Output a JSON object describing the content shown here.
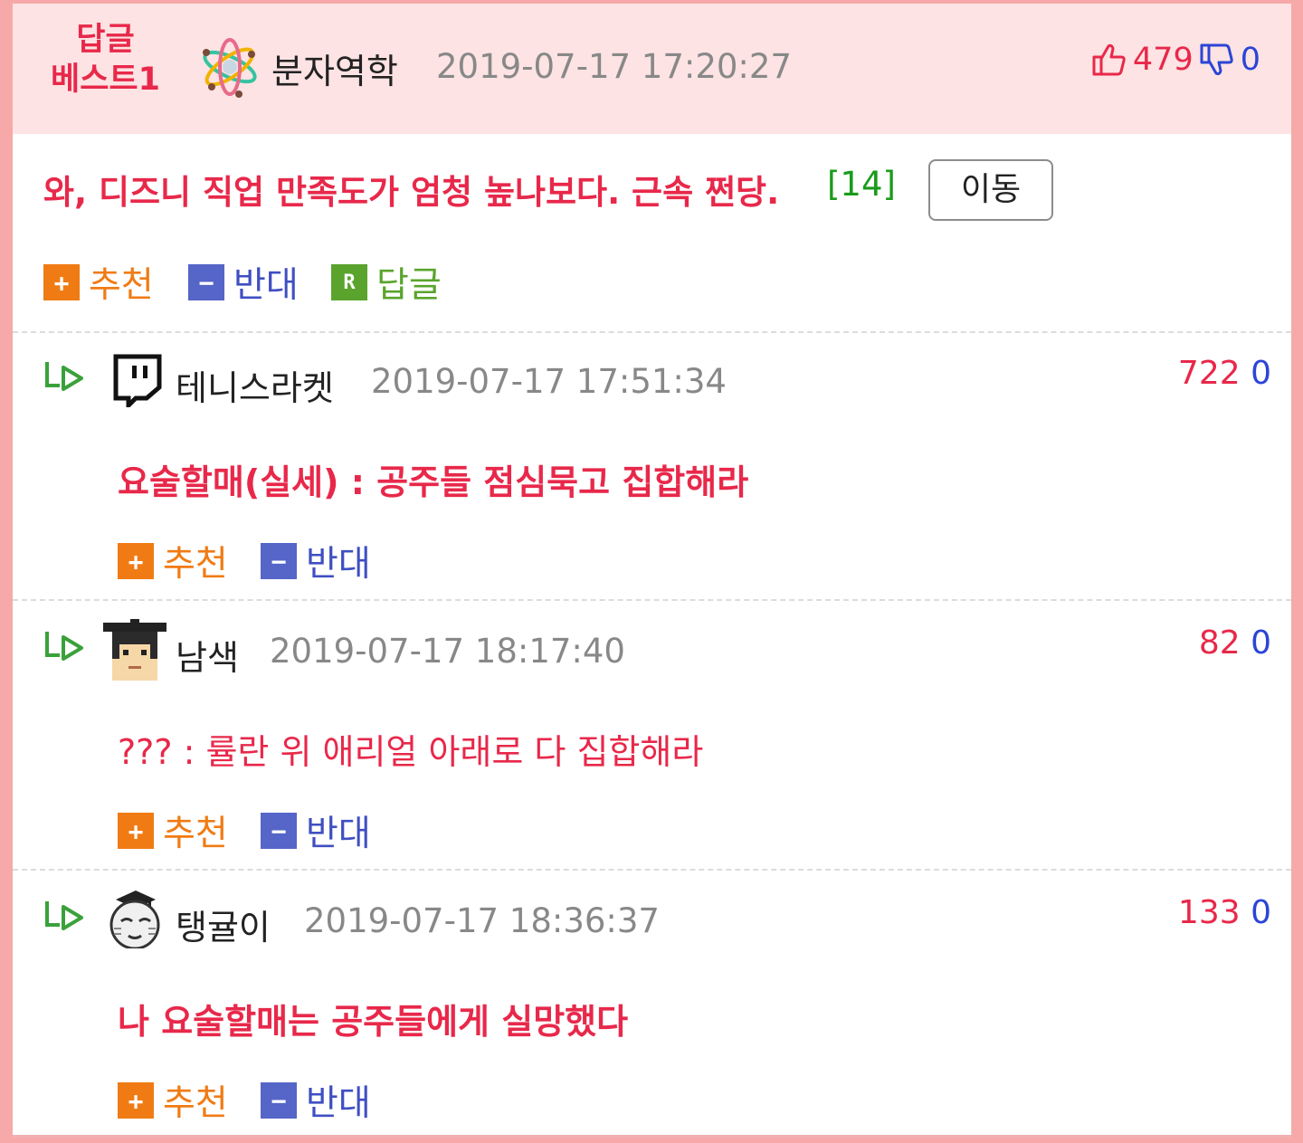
{
  "best": {
    "badge_line1": "답글",
    "badge_line2": "베스트1",
    "username": "분자역학",
    "date": "2019-07-17 17:20:27",
    "upvotes": "479",
    "downvotes": "0",
    "title": "와, 디즈니 직업 만족도가 엄청 높나보다. 근속 쩐당.",
    "reply_count": "[14]",
    "move_button": "이동"
  },
  "actions": {
    "recommend": "추천",
    "oppose": "반대",
    "reply": "답글",
    "plus_glyph": "+",
    "minus_glyph": "−",
    "reply_glyph": "R"
  },
  "comments": [
    {
      "username": "테니스라켓",
      "date": "2019-07-17 17:51:34",
      "upvotes": "722",
      "downvotes": "0",
      "text": "요술할매(실세) : 공주들 점심묵고 집합해라",
      "avatar": "twitch-icon"
    },
    {
      "username": "남색",
      "date": "2019-07-17 18:17:40",
      "upvotes": "82",
      "downvotes": "0",
      "text": "??? : 률란 위 애리얼 아래로 다 집합해라",
      "avatar": "graduate-boy-avatar"
    },
    {
      "username": "탱귤이",
      "date": "2019-07-17 18:36:37",
      "upvotes": "133",
      "downvotes": "0",
      "text": "나 요술할매는 공주들에게 실망했다",
      "avatar": "graduate-face-avatar"
    }
  ],
  "colors": {
    "accent_red": "#e8284a",
    "header_bg": "#fde3e3",
    "frame_border": "#f7a9a9",
    "recommend": "#f07b14",
    "oppose": "#5565c8",
    "reply": "#5aa42d",
    "down_blue": "#2b45d6"
  }
}
